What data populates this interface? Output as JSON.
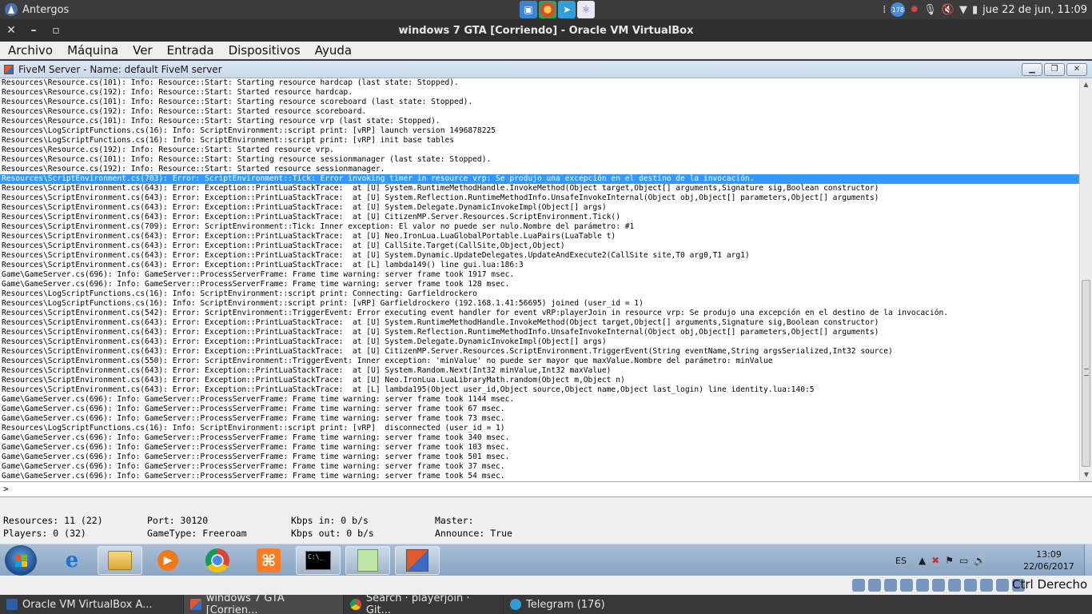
{
  "host": {
    "distro": "Antergos",
    "notif_count": "178",
    "datetime": "jue 22 de jun, 11:09"
  },
  "vbox": {
    "title": "windows 7 GTA [Corriendo] - Oracle VM VirtualBox",
    "menu": [
      "Archivo",
      "Máquina",
      "Ver",
      "Entrada",
      "Dispositivos",
      "Ayuda"
    ],
    "host_key": "Ctrl  Derecho"
  },
  "fivem": {
    "title": "FiveM Server - Name: default FiveM server",
    "prompt": ">",
    "selected_index": 10,
    "lines": [
      "Resources\\Resource.cs(101): Info: Resource::Start: Starting resource hardcap (last state: Stopped).",
      "Resources\\Resource.cs(192): Info: Resource::Start: Started resource hardcap.",
      "Resources\\Resource.cs(101): Info: Resource::Start: Starting resource scoreboard (last state: Stopped).",
      "Resources\\Resource.cs(192): Info: Resource::Start: Started resource scoreboard.",
      "Resources\\Resource.cs(101): Info: Resource::Start: Starting resource vrp (last state: Stopped).",
      "Resources\\LogScriptFunctions.cs(16): Info: ScriptEnvironment::script print: [vRP] launch version 1496878225",
      "Resources\\LogScriptFunctions.cs(16): Info: ScriptEnvironment::script print: [vRP] init base tables",
      "Resources\\Resource.cs(192): Info: Resource::Start: Started resource vrp.",
      "Resources\\Resource.cs(101): Info: Resource::Start: Starting resource sessionmanager (last state: Stopped).",
      "Resources\\Resource.cs(192): Info: Resource::Start: Started resource sessionmanager.",
      "Resources\\ScriptEnvironment.cs(703): Error: ScriptEnvironment::Tick: Error invoking timer in resource vrp: Se produjo una excepción en el destino de la invocación.",
      "Resources\\ScriptEnvironment.cs(643): Error: Exception::PrintLuaStackTrace:  at [U] System.RuntimeMethodHandle.InvokeMethod(Object target,Object[] arguments,Signature sig,Boolean constructor)",
      "Resources\\ScriptEnvironment.cs(643): Error: Exception::PrintLuaStackTrace:  at [U] System.Reflection.RuntimeMethodInfo.UnsafeInvokeInternal(Object obj,Object[] parameters,Object[] arguments)",
      "Resources\\ScriptEnvironment.cs(643): Error: Exception::PrintLuaStackTrace:  at [U] System.Delegate.DynamicInvokeImpl(Object[] args)",
      "Resources\\ScriptEnvironment.cs(643): Error: Exception::PrintLuaStackTrace:  at [U] CitizenMP.Server.Resources.ScriptEnvironment.Tick()",
      "Resources\\ScriptEnvironment.cs(709): Error: ScriptEnvironment::Tick: Inner exception: El valor no puede ser nulo.Nombre del parámetro: #1",
      "Resources\\ScriptEnvironment.cs(643): Error: Exception::PrintLuaStackTrace:  at [U] Neo.IronLua.LuaGlobalPortable.LuaPairs(LuaTable t)",
      "Resources\\ScriptEnvironment.cs(643): Error: Exception::PrintLuaStackTrace:  at [U] CallSite.Target(CallSite,Object,Object)",
      "Resources\\ScriptEnvironment.cs(643): Error: Exception::PrintLuaStackTrace:  at [U] System.Dynamic.UpdateDelegates.UpdateAndExecute2(CallSite site,T0 arg0,T1 arg1)",
      "Resources\\ScriptEnvironment.cs(643): Error: Exception::PrintLuaStackTrace:  at [L] lambda149() line gui.lua:186:3",
      "Game\\GameServer.cs(696): Info: GameServer::ProcessServerFrame: Frame time warning: server frame took 1917 msec.",
      "Game\\GameServer.cs(696): Info: GameServer::ProcessServerFrame: Frame time warning: server frame took 128 msec.",
      "Resources\\LogScriptFunctions.cs(16): Info: ScriptEnvironment::script print: Connecting: Garfieldrockero",
      "Resources\\LogScriptFunctions.cs(16): Info: ScriptEnvironment::script print: [vRP] Garfieldrockero (192.168.1.41:56695) joined (user_id = 1)",
      "Resources\\ScriptEnvironment.cs(542): Error: ScriptEnvironment::TriggerEvent: Error executing event handler for event vRP:playerJoin in resource vrp: Se produjo una excepción en el destino de la invocación.",
      "Resources\\ScriptEnvironment.cs(643): Error: Exception::PrintLuaStackTrace:  at [U] System.RuntimeMethodHandle.InvokeMethod(Object target,Object[] arguments,Signature sig,Boolean constructor)",
      "Resources\\ScriptEnvironment.cs(643): Error: Exception::PrintLuaStackTrace:  at [U] System.Reflection.RuntimeMethodInfo.UnsafeInvokeInternal(Object obj,Object[] parameters,Object[] arguments)",
      "Resources\\ScriptEnvironment.cs(643): Error: Exception::PrintLuaStackTrace:  at [U] System.Delegate.DynamicInvokeImpl(Object[] args)",
      "Resources\\ScriptEnvironment.cs(643): Error: Exception::PrintLuaStackTrace:  at [U] CitizenMP.Server.Resources.ScriptEnvironment.TriggerEvent(String eventName,String argsSerialized,Int32 source)",
      "Resources\\ScriptEnvironment.cs(550): Error: ScriptEnvironment::TriggerEvent: Inner exception: 'minValue' no puede ser mayor que maxValue.Nombre del parámetro: minValue",
      "Resources\\ScriptEnvironment.cs(643): Error: Exception::PrintLuaStackTrace:  at [U] System.Random.Next(Int32 minValue,Int32 maxValue)",
      "Resources\\ScriptEnvironment.cs(643): Error: Exception::PrintLuaStackTrace:  at [U] Neo.IronLua.LuaLibraryMath.random(Object m,Object n)",
      "Resources\\ScriptEnvironment.cs(643): Error: Exception::PrintLuaStackTrace:  at [L] lambda195(Object user_id,Object source,Object name,Object last_login) line identity.lua:140:5",
      "Game\\GameServer.cs(696): Info: GameServer::ProcessServerFrame: Frame time warning: server frame took 1144 msec.",
      "Game\\GameServer.cs(696): Info: GameServer::ProcessServerFrame: Frame time warning: server frame took 67 msec.",
      "Game\\GameServer.cs(696): Info: GameServer::ProcessServerFrame: Frame time warning: server frame took 73 msec.",
      "Resources\\LogScriptFunctions.cs(16): Info: ScriptEnvironment::script print: [vRP]  disconnected (user_id = 1)",
      "Game\\GameServer.cs(696): Info: GameServer::ProcessServerFrame: Frame time warning: server frame took 340 msec.",
      "Game\\GameServer.cs(696): Info: GameServer::ProcessServerFrame: Frame time warning: server frame took 103 msec.",
      "Game\\GameServer.cs(696): Info: GameServer::ProcessServerFrame: Frame time warning: server frame took 501 msec.",
      "Game\\GameServer.cs(696): Info: GameServer::ProcessServerFrame: Frame time warning: server frame took 37 msec.",
      "Game\\GameServer.cs(696): Info: GameServer::ProcessServerFrame: Frame time warning: server frame took 54 msec."
    ],
    "status": {
      "resources": "Resources: 11 (22)",
      "players": "Players: 0 (32)",
      "port": "Port: 30120",
      "gametype": "GameType: Freeroam",
      "kbps_in": "Kbps in: 0 b/s",
      "kbps_out": "Kbps out: 0 b/s",
      "master": "Master:",
      "announce": "Announce: True"
    }
  },
  "guest_taskbar": {
    "lang": "ES",
    "time": "13:09",
    "date": "22/06/2017"
  },
  "host_taskbar": {
    "items": [
      "Oracle VM VirtualBox A...",
      "windows 7 GTA [Corrien...",
      "Search · playerjoin · Git...",
      "Telegram (176)"
    ]
  }
}
